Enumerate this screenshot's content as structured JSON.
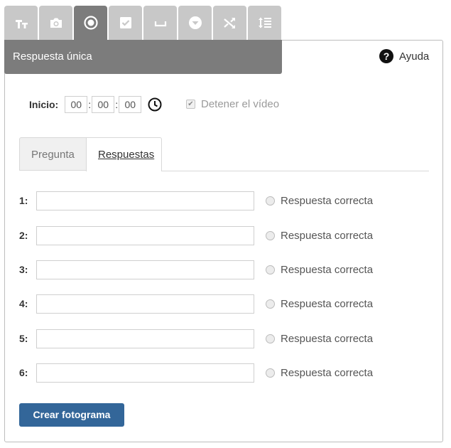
{
  "toolbar": {
    "tools": [
      {
        "icon": "text-size-icon"
      },
      {
        "icon": "camera-icon"
      },
      {
        "icon": "radio-selected-icon",
        "active": true
      },
      {
        "icon": "checkbox-icon"
      },
      {
        "icon": "blank-space-icon"
      },
      {
        "icon": "dropdown-icon"
      },
      {
        "icon": "shuffle-icon"
      },
      {
        "icon": "ordering-icon"
      }
    ]
  },
  "header": {
    "title": "Respuesta única"
  },
  "help": {
    "label": "Ayuda",
    "icon_glyph": "?"
  },
  "start": {
    "label": "Inicio:",
    "hours": "00",
    "minutes": "00",
    "seconds": "00",
    "separator": ":"
  },
  "stop_video": {
    "label": "Detener el vídeo",
    "checked": true
  },
  "tabs": [
    {
      "label": "Pregunta",
      "active": false
    },
    {
      "label": "Respuestas",
      "active": true
    }
  ],
  "answers": [
    {
      "number": "1:",
      "value": "",
      "radio_label": "Respuesta correcta"
    },
    {
      "number": "2:",
      "value": "",
      "radio_label": "Respuesta correcta"
    },
    {
      "number": "3:",
      "value": "",
      "radio_label": "Respuesta correcta"
    },
    {
      "number": "4:",
      "value": "",
      "radio_label": "Respuesta correcta"
    },
    {
      "number": "5:",
      "value": "",
      "radio_label": "Respuesta correcta"
    },
    {
      "number": "6:",
      "value": "",
      "radio_label": "Respuesta correcta"
    }
  ],
  "create_button": {
    "label": "Crear fotograma"
  },
  "colors": {
    "accent": "#336699",
    "header_bg": "#7c7c7c",
    "tool_bg": "#c8c8c8"
  }
}
